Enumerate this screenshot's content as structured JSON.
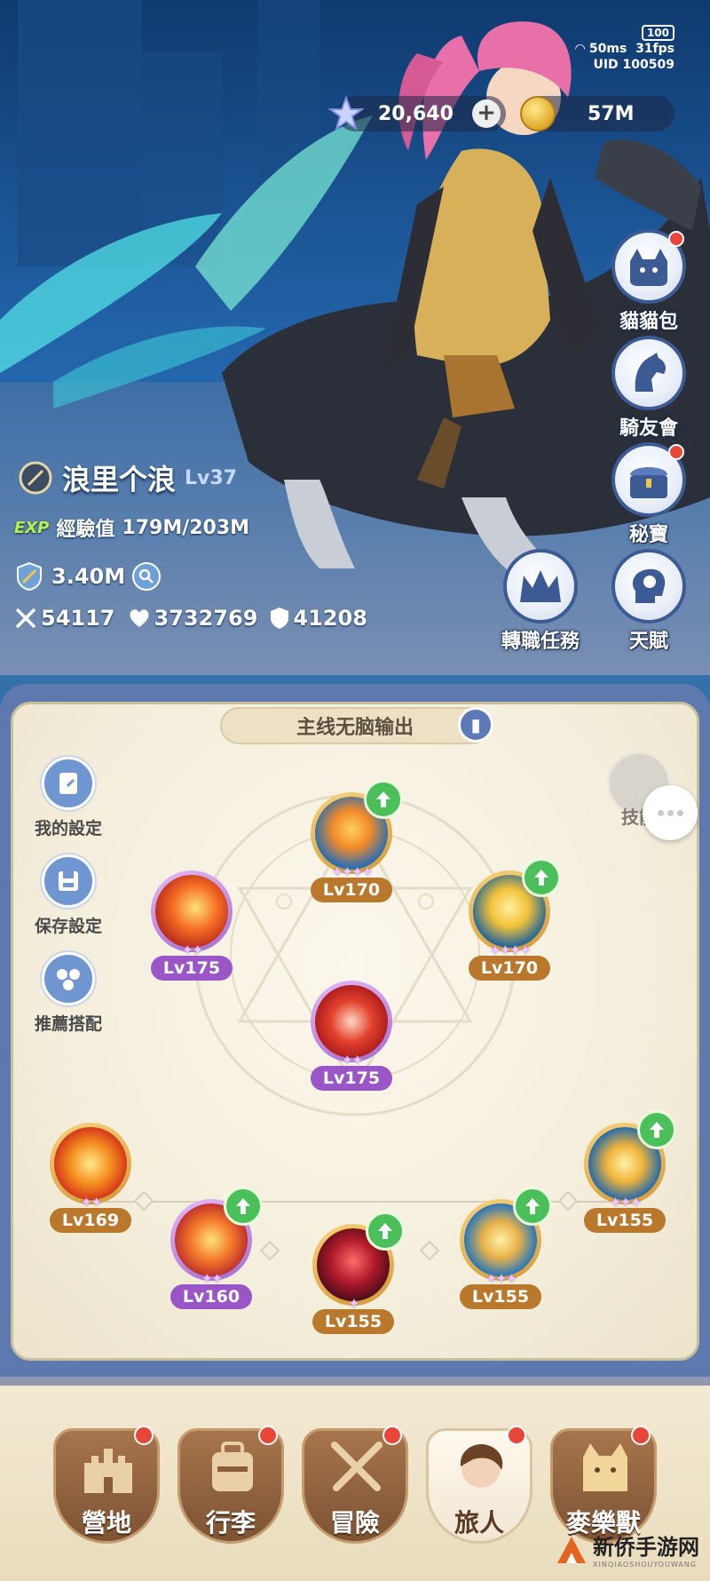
{
  "status": {
    "battery": "100",
    "ping": "50ms",
    "fps": "31fps",
    "uid": "UID 100509"
  },
  "currency": {
    "stars": "20,640",
    "gold": "57M"
  },
  "right_menu": [
    {
      "label": "貓貓包",
      "icon": "cat-bag-icon",
      "badge": true
    },
    {
      "label": "騎友會",
      "icon": "horse-icon",
      "badge": false
    },
    {
      "label": "秘寶",
      "icon": "treasure-icon",
      "badge": true
    },
    {
      "label": "轉職任務",
      "icon": "crown-icon",
      "badge": false
    },
    {
      "label": "天賦",
      "icon": "brain-icon",
      "badge": false
    }
  ],
  "player": {
    "name": "浪里个浪",
    "level": "Lv37",
    "exp_tag": "EXP",
    "exp_label": "經驗值",
    "exp_value": "179M/203M",
    "power": "3.40M",
    "attack": "54117",
    "hp": "3732769",
    "defense": "41208"
  },
  "panel": {
    "title": "主线无脑输出",
    "left_menu": [
      {
        "label": "我的設定"
      },
      {
        "label": "保存設定"
      },
      {
        "label": "推薦搭配"
      }
    ],
    "skill_chip": "技能"
  },
  "skills": [
    {
      "level": "Lv170",
      "stars": "✦✦✦✦",
      "upgrade": true
    },
    {
      "level": "Lv175",
      "stars": "✦✦",
      "upgrade": false
    },
    {
      "level": "Lv170",
      "stars": "✦✦✦✦",
      "upgrade": true
    },
    {
      "level": "Lv175",
      "stars": "✦✦",
      "upgrade": false
    },
    {
      "level": "Lv169",
      "stars": "✦✦",
      "upgrade": false
    },
    {
      "level": "Lv160",
      "stars": "✦✦",
      "upgrade": true
    },
    {
      "level": "Lv155",
      "stars": "✦",
      "upgrade": true
    },
    {
      "level": "Lv155",
      "stars": "✦✦✦",
      "upgrade": true
    },
    {
      "level": "Lv155",
      "stars": "✦✦✦",
      "upgrade": true
    }
  ],
  "bottom_nav": [
    {
      "label": "營地",
      "badge": true,
      "active": false
    },
    {
      "label": "行李",
      "badge": true,
      "active": false
    },
    {
      "label": "冒險",
      "badge": true,
      "active": false
    },
    {
      "label": "旅人",
      "badge": true,
      "active": true
    },
    {
      "label": "麥樂獸",
      "badge": true,
      "active": false
    }
  ],
  "watermark": {
    "title": "新侨手游网",
    "sub": "XINQIAOSHOUYOUWANG"
  },
  "colors": {
    "accent_blue": "#5d7ab8",
    "badge_red": "#e84638",
    "upgrade_green": "#4bbf5a",
    "tab_brown": "#8a5c3a"
  }
}
